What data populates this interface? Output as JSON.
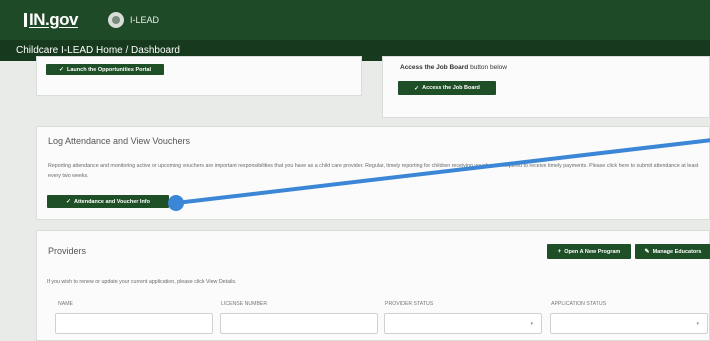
{
  "header": {
    "logo_text": "IN.gov",
    "app_name": "I-LEAD"
  },
  "breadcrumb": "Childcare I-LEAD Home / Dashboard",
  "opportunities": {
    "button_label": "Launch the Opportunities Portal"
  },
  "job_board": {
    "title_bold": "Access the Job Board",
    "title_rest": "button below",
    "button_label": "Access the Job Board"
  },
  "attendance": {
    "title": "Log Attendance and View Vouchers",
    "text": "Reporting attendance and monitoring active or upcoming vouchers are important responsibilities that you have as a child care provider. Regular, timely reporting for children receiving vouchers is required to receive timely payments. Please click here to submit attendance at least every two weeks.",
    "button_label": "Attendance and Voucher Info"
  },
  "providers": {
    "title": "Providers",
    "open_program_label": "Open A New Program",
    "manage_educators_label": "Manage Educators",
    "help_text": "If you wish to renew or update your current application, please click View Details.",
    "columns": [
      "NAME",
      "LICENSE NUMBER",
      "PROVIDER STATUS",
      "APPLICATION STATUS"
    ]
  },
  "icons": {
    "check": "check-icon",
    "plus": "plus-icon",
    "manage": "edit-icon",
    "caret": "chevron-down-icon"
  },
  "colors": {
    "brand_green": "#1f4a27",
    "crumb_green": "#173a1e",
    "annotation_blue": "#3b86d6"
  }
}
